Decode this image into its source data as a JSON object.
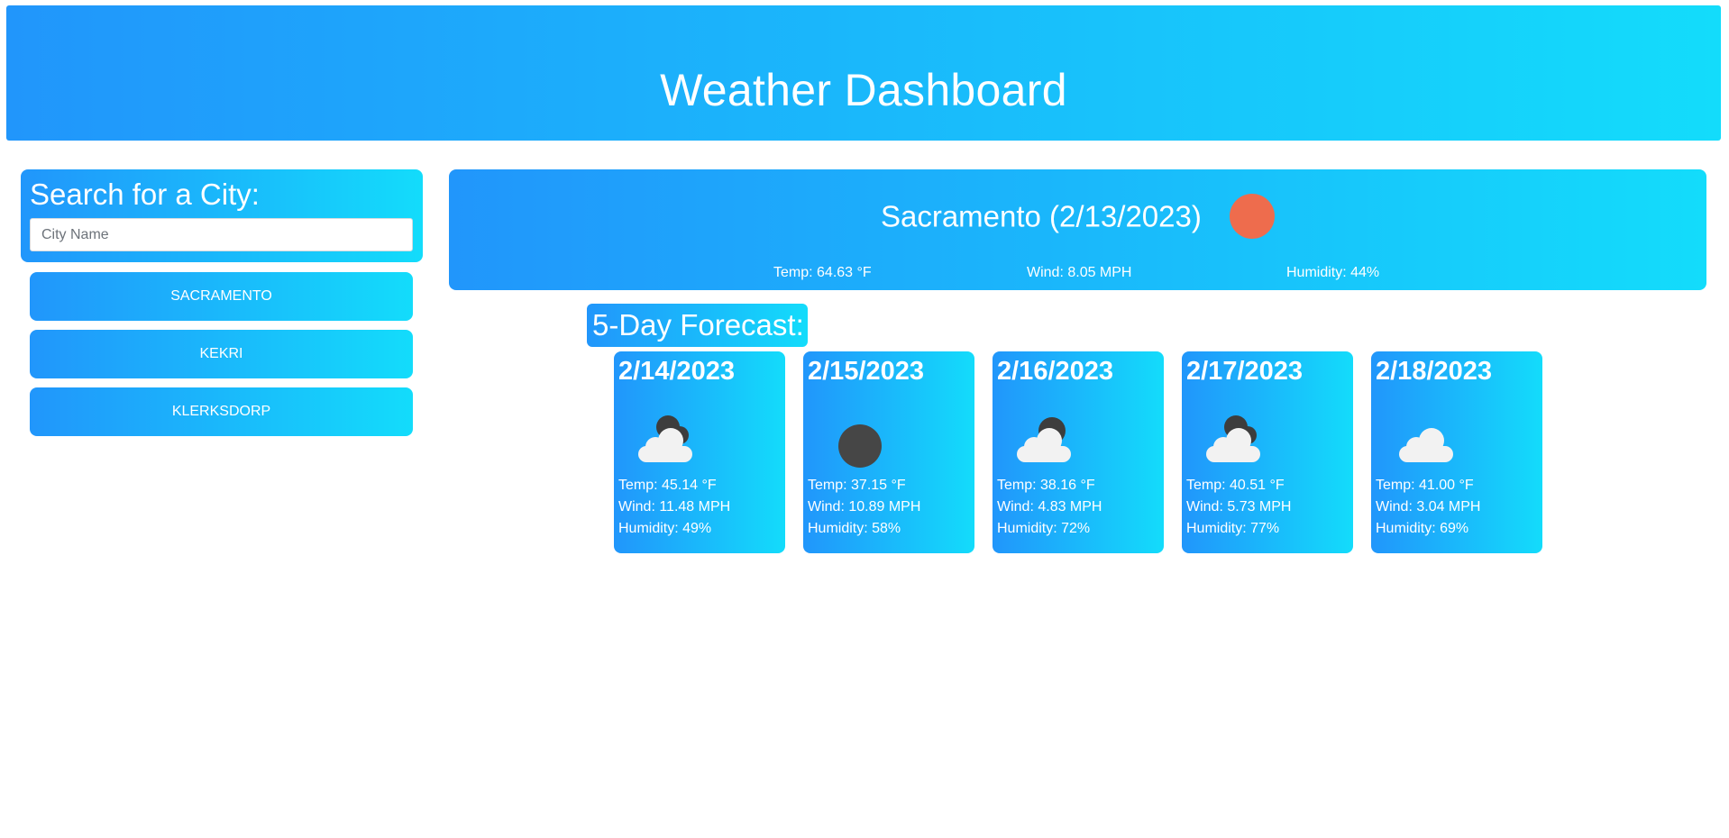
{
  "header": {
    "title": "Weather Dashboard"
  },
  "search": {
    "title": "Search for a City:",
    "placeholder": "City Name",
    "value": "",
    "history": [
      "Sacramento",
      "Kekri",
      "Klerksdorp"
    ]
  },
  "current": {
    "title": "Sacramento (2/13/2023)",
    "icon": "sun-icon",
    "temp": "Temp: 64.63 °F",
    "wind": "Wind: 8.05 MPH",
    "humidity": "Humidity: 44%"
  },
  "forecast": {
    "title": "5-Day Forecast:",
    "days": [
      {
        "date": "2/14/2023",
        "icon": "broken-clouds-icon",
        "temp": "Temp: 45.14 °F",
        "wind": "Wind: 11.48 MPH",
        "humidity": "Humidity: 49%"
      },
      {
        "date": "2/15/2023",
        "icon": "overcast-icon",
        "temp": "Temp: 37.15 °F",
        "wind": "Wind: 10.89 MPH",
        "humidity": "Humidity: 58%"
      },
      {
        "date": "2/16/2023",
        "icon": "scattered-clouds-icon",
        "temp": "Temp: 38.16 °F",
        "wind": "Wind: 4.83 MPH",
        "humidity": "Humidity: 72%"
      },
      {
        "date": "2/17/2023",
        "icon": "broken-clouds-icon",
        "temp": "Temp: 40.51 °F",
        "wind": "Wind: 5.73 MPH",
        "humidity": "Humidity: 77%"
      },
      {
        "date": "2/18/2023",
        "icon": "cloud-icon",
        "temp": "Temp: 41.00 °F",
        "wind": "Wind: 3.04 MPH",
        "humidity": "Humidity: 69%"
      }
    ]
  },
  "colors": {
    "gradient_start": "#2196fb",
    "gradient_end": "#13dcfb",
    "sun": "#ee6c4d",
    "cloud_light": "#f2f2f2",
    "cloud_dark": "#3d3d3d"
  }
}
